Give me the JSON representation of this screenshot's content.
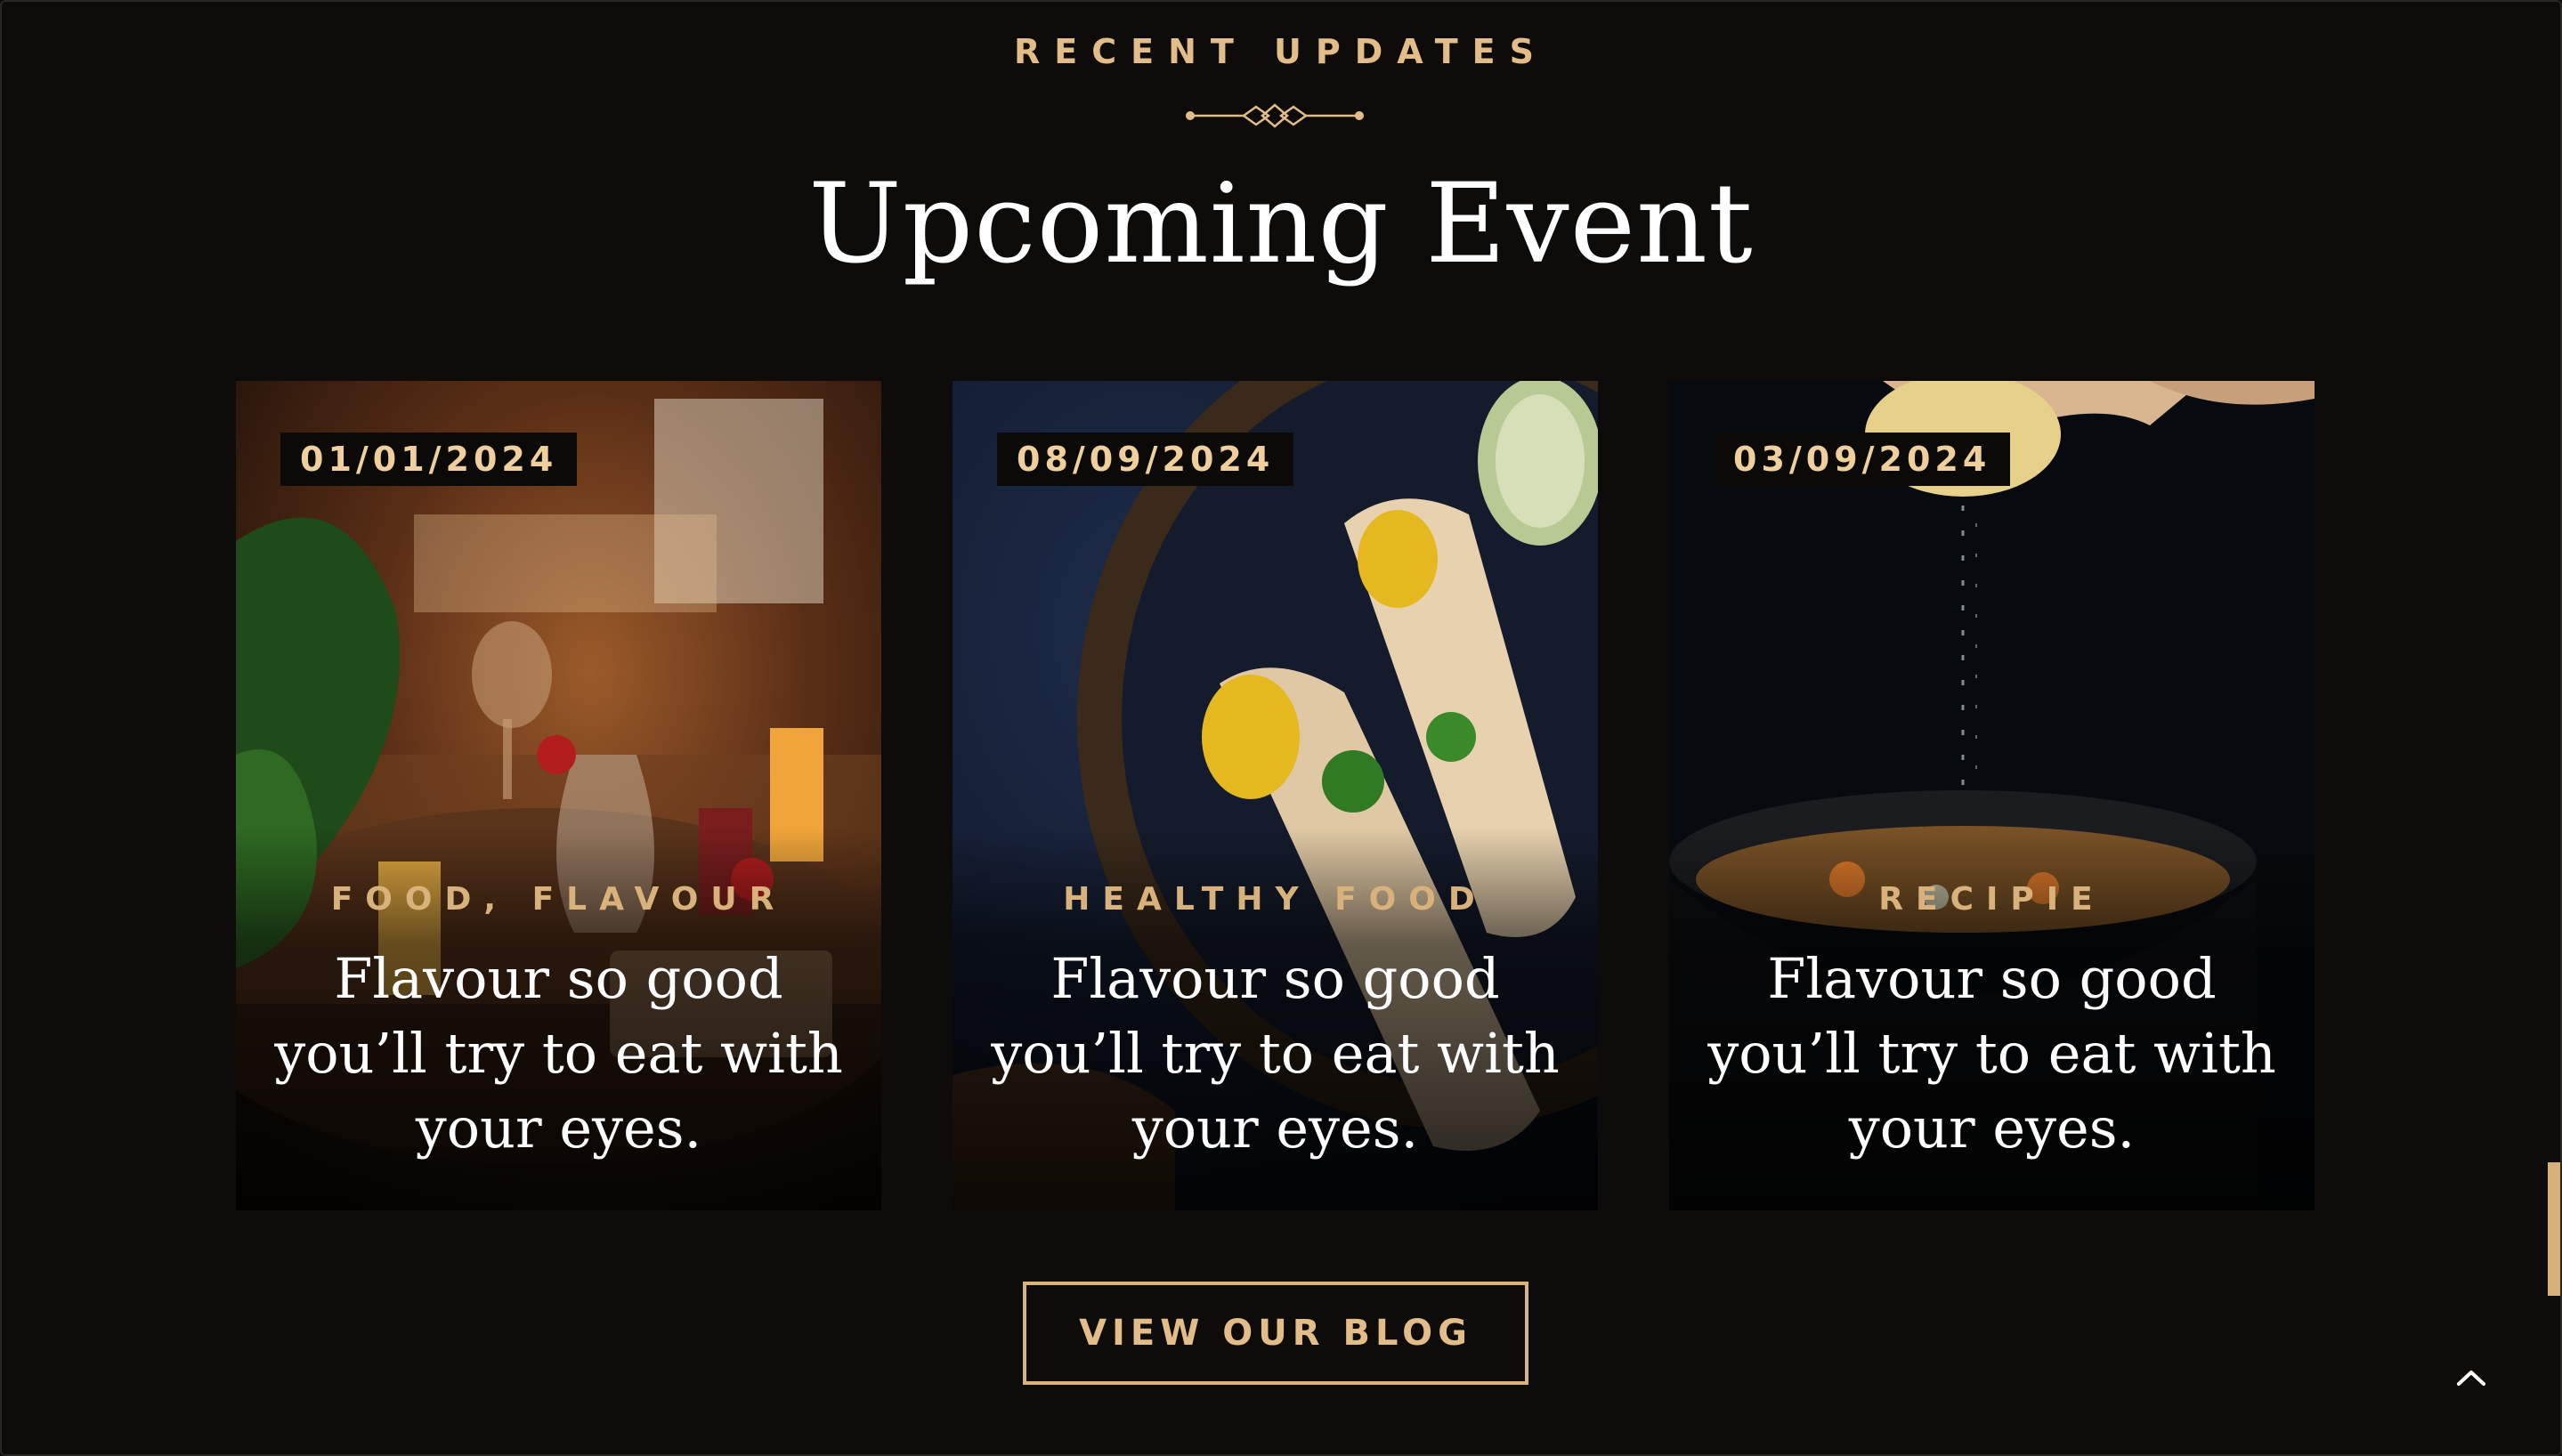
{
  "section": {
    "eyebrow": "RECENT UPDATES",
    "title": "Upcoming Event"
  },
  "cards": [
    {
      "date": "01/01/2024",
      "category": "FOOD, FLAVOUR",
      "headline": "Flavour so good you’ll try to eat with your eyes.",
      "image": "restaurant-table-with-wine-and-drinks"
    },
    {
      "date": "08/09/2024",
      "category": "HEALTHY FOOD",
      "headline": "Flavour so good you’ll try to eat with your eyes.",
      "image": "masala-dosa-on-plate"
    },
    {
      "date": "03/09/2024",
      "category": "RECIPIE",
      "headline": "Flavour so good you’ll try to eat with your eyes.",
      "image": "lemon-squeezed-over-soup-bowl"
    }
  ],
  "cta": {
    "label": "VIEW OUR BLOG"
  },
  "icons": {
    "ornament": "diamond-divider-icon",
    "back_to_top": "chevron-up-icon"
  },
  "colors": {
    "background": "#0d0c0b",
    "accent": "#e3bd88",
    "heading": "#ffffff"
  }
}
